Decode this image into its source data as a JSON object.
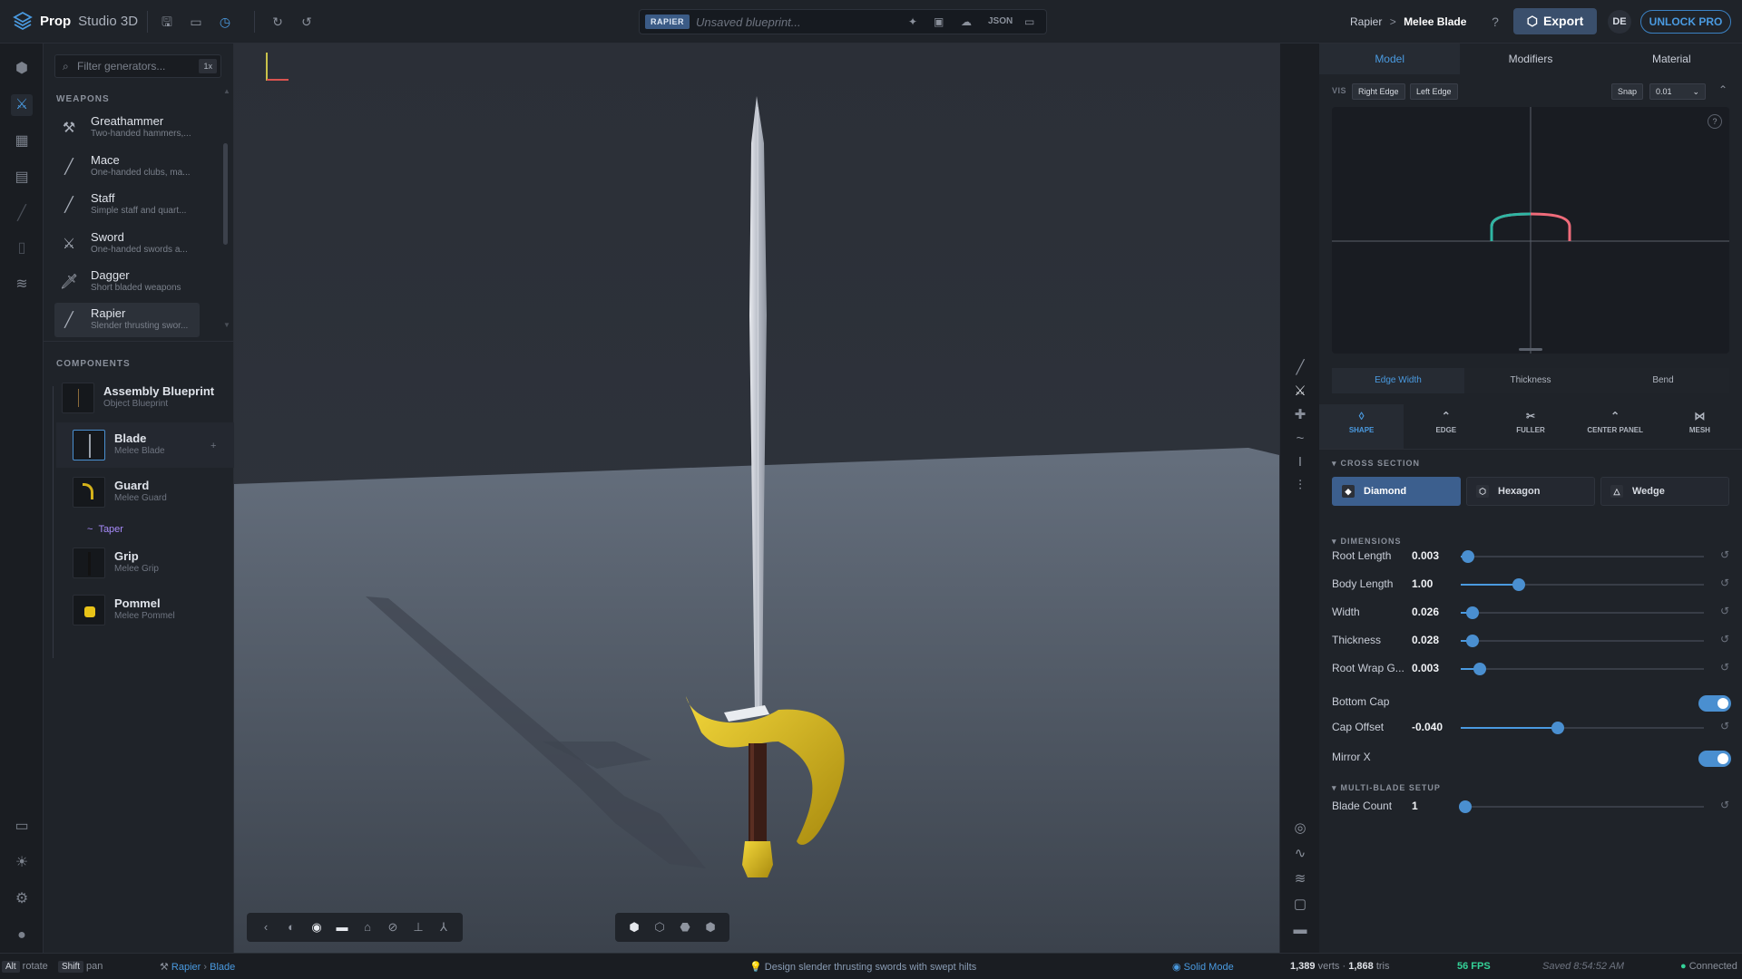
{
  "app": {
    "name_bold": "Prop",
    "name_rest": "Studio 3D"
  },
  "doc": {
    "badge": "RAPIER",
    "title": "Unsaved blueprint...",
    "json_label": "JSON"
  },
  "breadcrumb": {
    "parent": "Rapier",
    "sep": ">",
    "current": "Melee Blade"
  },
  "actions": {
    "export": "Export",
    "avatar": "DE",
    "unlock": "UNLOCK PRO"
  },
  "filter": {
    "placeholder": "Filter generators...",
    "key": "1x"
  },
  "weapons_header": "WEAPONS",
  "generators": [
    {
      "title": "Greathammer",
      "sub": "Two-handed hammers,..."
    },
    {
      "title": "Mace",
      "sub": "One-handed clubs, ma..."
    },
    {
      "title": "Staff",
      "sub": "Simple staff and quart..."
    },
    {
      "title": "Sword",
      "sub": "One-handed swords a..."
    },
    {
      "title": "Dagger",
      "sub": "Short bladed weapons"
    },
    {
      "title": "Rapier",
      "sub": "Slender thrusting swor..."
    }
  ],
  "components_header": "COMPONENTS",
  "components": [
    {
      "title": "Assembly Blueprint",
      "sub": "Object Blueprint"
    },
    {
      "title": "Blade",
      "sub": "Melee Blade"
    },
    {
      "title": "Guard",
      "sub": "Melee Guard"
    },
    {
      "title": "Grip",
      "sub": "Melee Grip"
    },
    {
      "title": "Pommel",
      "sub": "Melee Pommel"
    }
  ],
  "taper_label": "Taper",
  "right_tabs": [
    "Model",
    "Modifiers",
    "Material"
  ],
  "vis": {
    "label": "VIS",
    "right_edge": "Right Edge",
    "left_edge": "Left Edge",
    "snap": "Snap",
    "snap_value": "0.01"
  },
  "profile_tabs": [
    "Edge Width",
    "Thickness",
    "Bend"
  ],
  "mod_tabs": [
    "SHAPE",
    "EDGE",
    "FULLER",
    "CENTER PANEL",
    "MESH"
  ],
  "cross_section": {
    "header": "CROSS SECTION",
    "options": [
      "Diamond",
      "Hexagon",
      "Wedge"
    ]
  },
  "dimensions": {
    "header": "DIMENSIONS",
    "params": [
      {
        "label": "Root Length",
        "value": "0.003",
        "level": 0.03
      },
      {
        "label": "Body Length",
        "value": "1.00",
        "level": 0.24
      },
      {
        "label": "Width",
        "value": "0.026",
        "level": 0.05
      },
      {
        "label": "Thickness",
        "value": "0.028",
        "level": 0.05
      },
      {
        "label": "Root Wrap G...",
        "value": "0.003",
        "level": 0.08
      }
    ],
    "bottom_cap": "Bottom Cap",
    "cap_offset": {
      "label": "Cap Offset",
      "value": "-0.040",
      "level": 0.4
    },
    "mirror_x": "Mirror X"
  },
  "multi_blade": {
    "header": "MULTI-BLADE SETUP",
    "label": "Blade Count",
    "value": "1",
    "level": 0.02
  },
  "status": {
    "alt": "Alt",
    "rotate": "rotate",
    "shift": "Shift",
    "pan": "pan",
    "crumb_parent": "Rapier",
    "crumb_child": "Blade",
    "tip": "Design slender thrusting swords with swept hilts",
    "mode": "Solid Mode",
    "verts": "1,389",
    "verts_label": "verts ·",
    "tris": "1,868",
    "tris_label": "tris",
    "fps": "56 FPS",
    "saved": "Saved 8:54:52 AM",
    "connected": "Connected"
  },
  "colors": {
    "accent": "#4a9ae0",
    "gold": "#d4b21a",
    "blade": "#c9ccd3"
  }
}
